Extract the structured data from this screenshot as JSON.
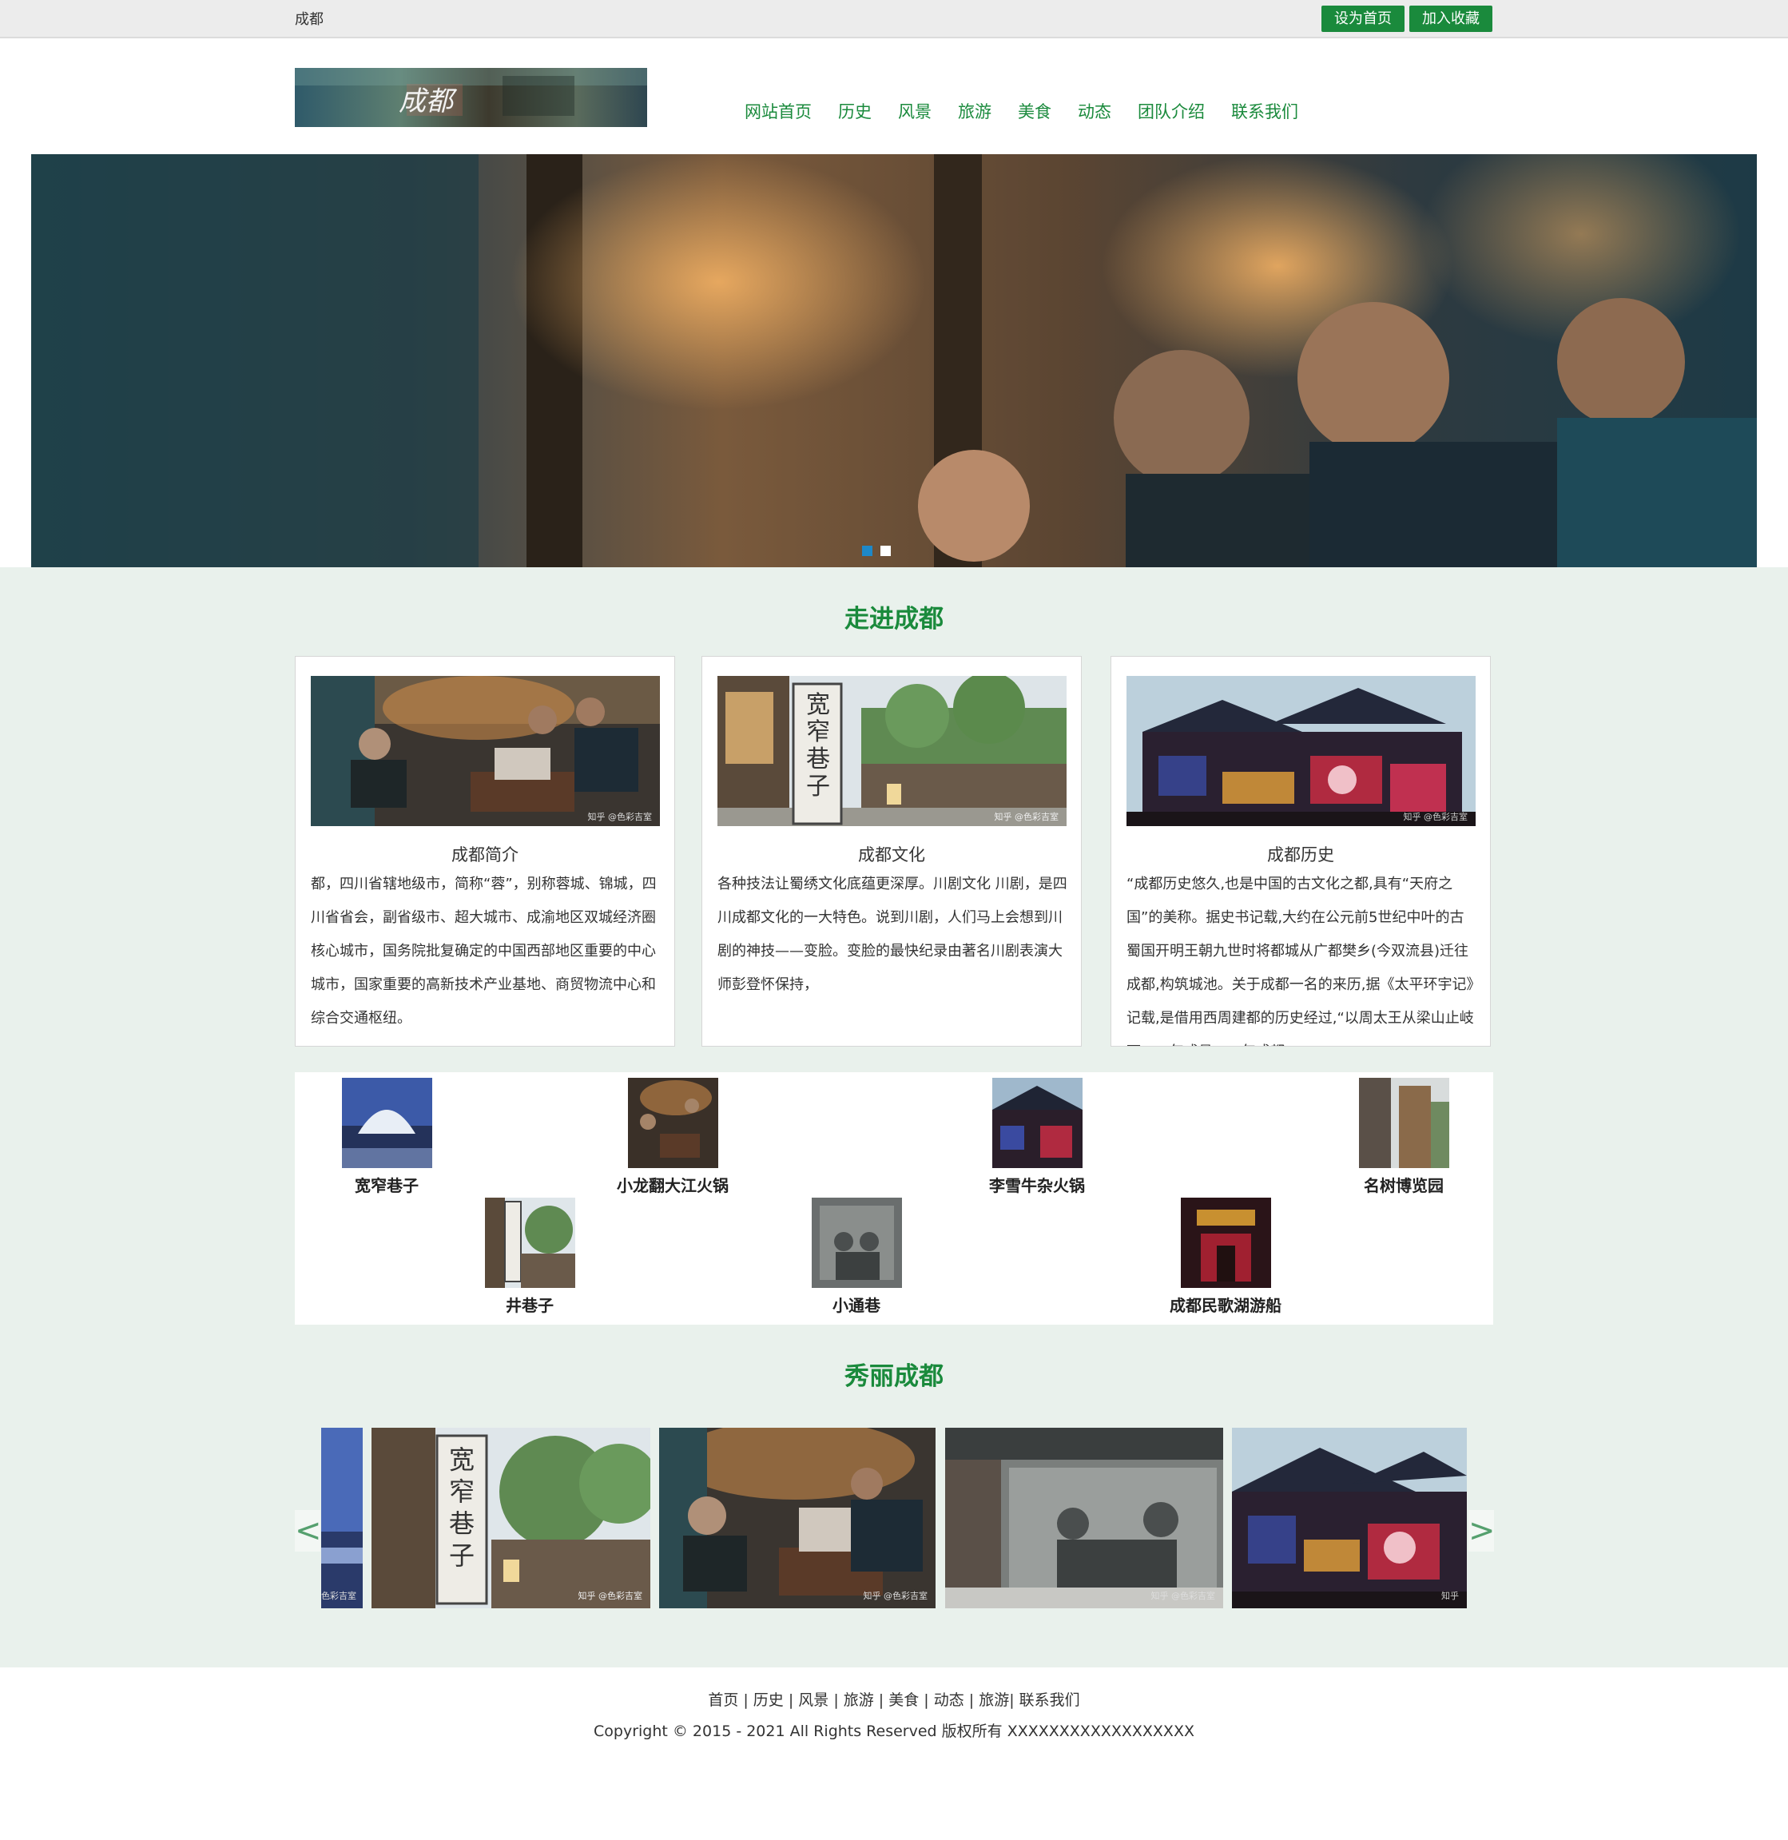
{
  "topbar": {
    "city": "成都",
    "set_home": "设为首页",
    "add_favorite": "加入收藏"
  },
  "header": {
    "logo_text": "成都",
    "nav": [
      "网站首页",
      "历史",
      "风景",
      "旅游",
      "美食",
      "动态",
      "团队介绍",
      "联系我们"
    ]
  },
  "hero": {
    "slide_count": 2,
    "active_slide": 1
  },
  "section1": {
    "title": "走进成都",
    "cards": [
      {
        "title": "成都简介",
        "text": "都，四川省辖地级市，简称“蓉”，别称蓉城、锦城，四川省省会，副省级市、超大城市、成渝地区双城经济圈核心城市，国务院批复确定的中国西部地区重要的中心城市，国家重要的高新技术产业基地、商贸物流中心和综合交通枢纽。",
        "watermark": "知乎 @色彩吉室"
      },
      {
        "title": "成都文化",
        "text": "各种技法让蜀绣文化底蕴更深厚。川剧文化 川剧，是四川成都文化的一大特色。说到川剧，人们马上会想到川剧的神技——变脸。变脸的最快纪录由著名川剧表演大师彭登怀保持，",
        "sign_text": "宽窄巷子",
        "watermark": "知乎 @色彩吉室"
      },
      {
        "title": "成都历史",
        "text": "“成都历史悠久,也是中国的古文化之都,具有“天府之国”的美称。据史书记载,大约在公元前5世纪中叶的古蜀国开明王朝九世时将都城从广都樊乡(今双流县)迁往成都,构筑城池。关于成都一名的来历,据《太平环宇记》记载,是借用西周建都的历史经过,“以周太王从梁山止岐下，一年成邑，二年成都",
        "watermark": "知乎 @色彩吉室"
      }
    ]
  },
  "places": {
    "row1": [
      "宽窄巷子",
      "小龙翻大江火锅",
      "李雪牛杂火锅",
      "名树博览园"
    ],
    "row2": [
      "井巷子",
      "小通巷",
      "成都民歌湖游船"
    ]
  },
  "section2": {
    "title": "秀丽成都",
    "prev": "<",
    "next": ">",
    "watermarks": [
      "色彩吉室",
      "知乎 @色彩吉室",
      "知乎 @色彩吉室",
      "知乎 @色彩吉室",
      "知乎"
    ]
  },
  "footer": {
    "links": "首页 | 历史 | 风景 | 旅游 | 美食 | 动态 | 旅游| 联系我们",
    "copyright": "Copyright © 2015 - 2021 All Rights Reserved 版权所有 XXXXXXXXXXXXXXXXXX"
  },
  "colors": {
    "accent_green": "#1a8a3c",
    "mint_background": "#e9f1ec",
    "slider_dot_active": "#1e88c8"
  }
}
